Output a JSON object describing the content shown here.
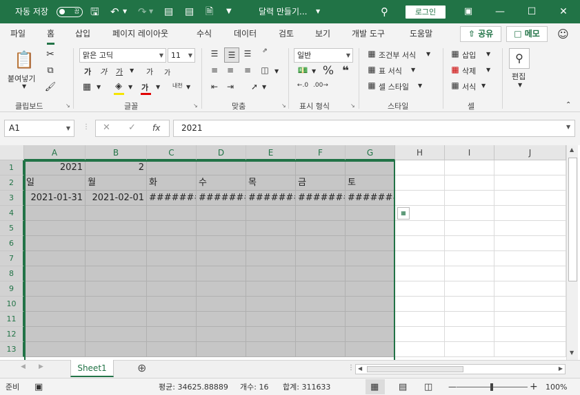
{
  "titlebar": {
    "autosave_label": "자동 저장",
    "autosave_state": "끔",
    "doc_title": "달력 만들기...",
    "login_label": "로그인"
  },
  "tabs": [
    "파일",
    "홈",
    "삽입",
    "페이지 레이아웃",
    "수식",
    "데이터",
    "검토",
    "보기",
    "개발 도구",
    "도움말"
  ],
  "share_label": "공유",
  "memo_label": "메모",
  "ribbon": {
    "clipboard": {
      "paste_label": "붙여넣기",
      "group_label": "클립보드"
    },
    "font": {
      "font_name": "맑은 고딕",
      "font_size": "11",
      "bold": "가",
      "italic": "가",
      "underline": "가",
      "grow": "가",
      "shrink": "가",
      "font_color": "가",
      "phonetic": "내천",
      "group_label": "글꼴"
    },
    "alignment": {
      "group_label": "맞춤"
    },
    "number": {
      "format": "일반",
      "group_label": "표시 형식"
    },
    "styles": {
      "conditional": "조건부 서식",
      "table": "표 서식",
      "cell": "셀 스타일",
      "group_label": "스타일"
    },
    "cells": {
      "insert": "삽입",
      "delete": "삭제",
      "format": "서식",
      "group_label": "셀"
    },
    "editing": {
      "label": "편집"
    }
  },
  "formula_bar": {
    "name_box": "A1",
    "fx": "fx",
    "value": "2021"
  },
  "columns": [
    "A",
    "B",
    "C",
    "D",
    "E",
    "F",
    "G",
    "H",
    "I",
    "J"
  ],
  "rows": [
    "1",
    "2",
    "3",
    "4",
    "5",
    "6",
    "7",
    "8",
    "9",
    "10",
    "11",
    "12",
    "13"
  ],
  "cells": {
    "r1": [
      "2021",
      "2",
      "",
      "",
      "",
      "",
      ""
    ],
    "r2": [
      "일",
      "월",
      "화",
      "수",
      "목",
      "금",
      "토"
    ],
    "r3": [
      "2021-01-31",
      "2021-02-01",
      "#######",
      "#######",
      "#######",
      "#######",
      "#######"
    ]
  },
  "sheet_tab": "Sheet1",
  "status": {
    "ready": "준비",
    "average": "평균: 34625.88889",
    "count": "개수: 16",
    "sum": "합계: 311633",
    "zoom": "100%"
  },
  "colors": {
    "accent": "#217346",
    "selection": "#c6c6c6"
  }
}
